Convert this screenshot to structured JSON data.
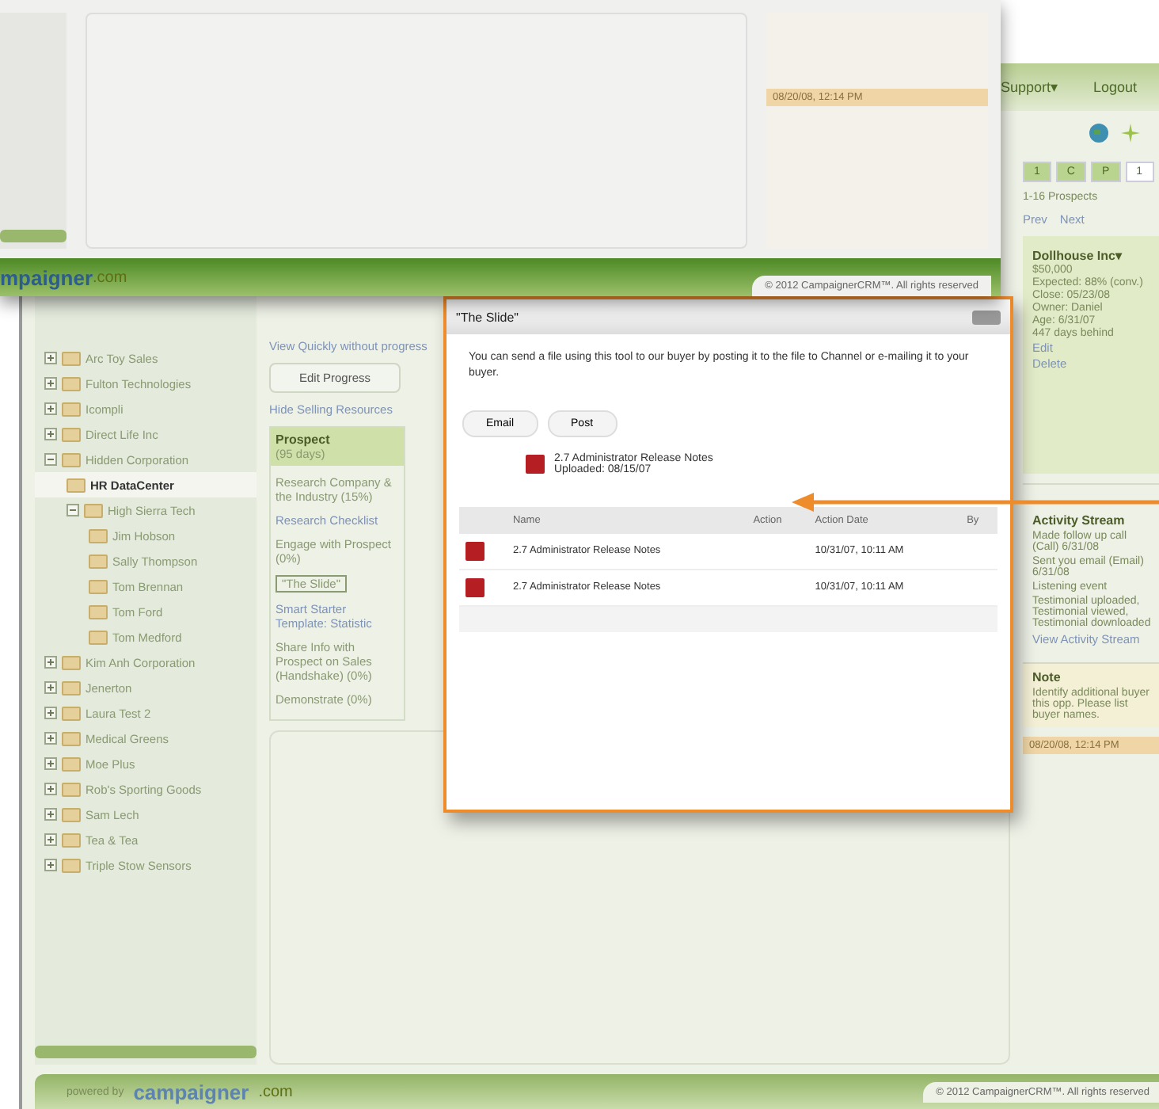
{
  "back_window": {
    "menu": [
      "Support▾",
      "Logout"
    ],
    "pager": {
      "buttons": [
        "1",
        "C",
        "P",
        "1"
      ],
      "count": "1-16 Prospects",
      "prev": "Prev",
      "next": "Next"
    },
    "tree": [
      {
        "label": "Arc Toy Sales",
        "expanded": false,
        "selected": false
      },
      {
        "label": "Fulton Technologies",
        "expanded": false,
        "selected": false
      },
      {
        "label": "Icompli",
        "expanded": false,
        "selected": false
      },
      {
        "label": "Direct Life Inc",
        "expanded": false,
        "selected": false
      },
      {
        "label": "Hidden Corporation",
        "expanded": true,
        "selected": false,
        "children": [
          {
            "label": "HR DataCenter",
            "selected": true
          },
          {
            "label": "High Sierra Tech",
            "expanded": true,
            "selected": false,
            "children": [
              {
                "label": "Jim Hobson",
                "selected": false
              },
              {
                "label": "Sally Thompson",
                "selected": false
              },
              {
                "label": "Tom Brennan",
                "selected": false
              },
              {
                "label": "Tom Ford",
                "selected": false
              },
              {
                "label": "Tom Medford",
                "selected": false
              }
            ]
          }
        ]
      },
      {
        "label": "Kim Anh Corporation",
        "expanded": false,
        "selected": false
      },
      {
        "label": "Jenerton",
        "expanded": false,
        "selected": false
      },
      {
        "label": "Laura Test 2",
        "expanded": false,
        "selected": false
      },
      {
        "label": "Medical Greens",
        "expanded": false,
        "selected": false
      },
      {
        "label": "Moe Plus",
        "expanded": false,
        "selected": false
      },
      {
        "label": "Rob's Sporting Goods",
        "expanded": false,
        "selected": false
      },
      {
        "label": "Sam Lech",
        "expanded": false,
        "selected": false
      },
      {
        "label": "Tea & Tea",
        "expanded": false,
        "selected": false
      },
      {
        "label": "Triple Stow Sensors",
        "expanded": false,
        "selected": false
      }
    ],
    "progress": {
      "view_link": "View Quickly without progress",
      "edit_button": "Edit Progress",
      "hide_link": "Hide Selling Resources",
      "stage": "Prospect",
      "stage_days": "(95 days)",
      "steps": [
        {
          "kind": "step",
          "text": "Research Company & the Industry (15%)"
        },
        {
          "kind": "link",
          "text": "Research Checklist"
        },
        {
          "kind": "step",
          "text": "Engage with Prospect (0%)"
        },
        {
          "kind": "boxed",
          "text": "\"The Slide\""
        },
        {
          "kind": "link",
          "text": "Smart Starter Template: Statistic"
        },
        {
          "kind": "step",
          "text": "Share Info with Prospect on Sales (Handshake) (0%)"
        },
        {
          "kind": "step",
          "text": "Demonstrate (0%)"
        }
      ]
    },
    "deal": {
      "name": "Dollhouse Inc▾",
      "lines": [
        "$50,000",
        "Expected: 88% (conv.)",
        "Close: 05/23/08",
        "Owner: Daniel",
        "Age: 6/31/07",
        "447 days behind"
      ],
      "links": [
        "Edit",
        "Delete"
      ]
    },
    "activity": {
      "title": "Activity Stream",
      "items": [
        "Made follow up call (Call) 6/31/08",
        "Sent you email (Email) 6/31/08",
        "Listening event",
        "Testimonial uploaded, Testimonial viewed, Testimonial downloaded"
      ],
      "link": "View Activity Stream"
    },
    "note": {
      "title": "Note",
      "text": "Identify additional buyer this opp. Please list buyer names."
    },
    "note_bar": "08/20/08, 12:14 PM",
    "footer": {
      "powered": "powered by",
      "logo": "campaigner",
      ".com": ".com",
      "copyright": "© 2012 CampaignerCRM™. All rights reserved"
    }
  },
  "top_window": {
    "note_bar": "08/20/08, 12:14 PM",
    "logo": "mpaigner",
    "logo_suffix": ".com",
    "copyright": "© 2012 CampaignerCRM™. All rights reserved"
  },
  "dialog": {
    "title": "\"The Slide\"",
    "text": "You can send a file using this tool to our buyer by posting it to the file to Channel or e-mailing it to your buyer.",
    "buttons": [
      "Email",
      "Post"
    ],
    "file": {
      "name": "2.7 Administrator Release Notes",
      "uploaded": "Uploaded: 08/15/07"
    },
    "table": {
      "columns": [
        "Name",
        "Action",
        "Action Date",
        "By"
      ],
      "rows": [
        [
          "2.7 Administrator Release Notes",
          "",
          "10/31/07, 10:11 AM",
          ""
        ],
        [
          "2.7 Administrator Release Notes",
          "",
          "10/31/07, 10:11 AM",
          ""
        ]
      ]
    }
  }
}
